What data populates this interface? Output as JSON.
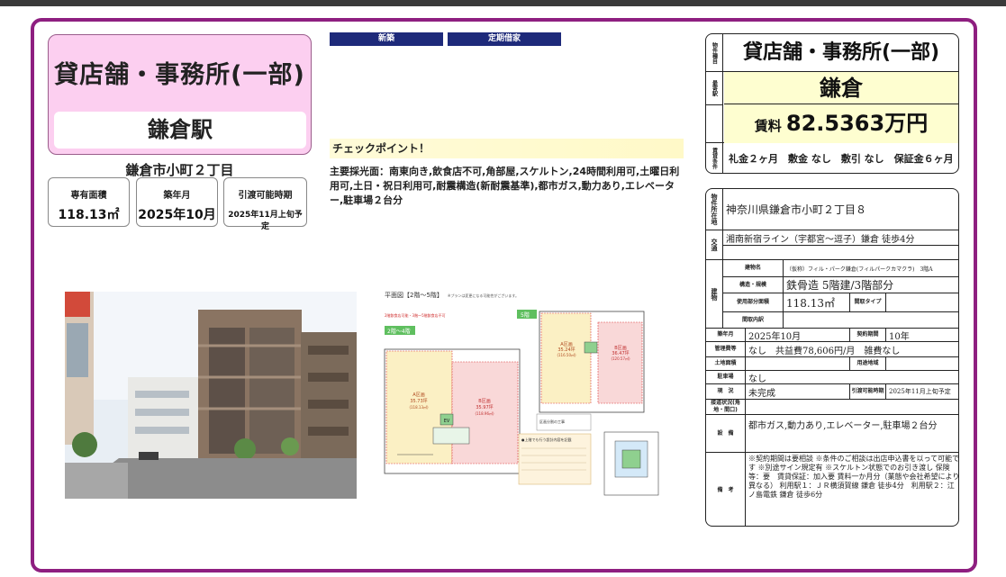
{
  "listing": {
    "type": "貸店舗・事務所(一部)",
    "station": "鎌倉駅",
    "address_short": "鎌倉市小町２丁目",
    "specs": [
      {
        "label": "専有面積",
        "value": "118.13㎡"
      },
      {
        "label": "築年月",
        "value": "2025年10月"
      },
      {
        "label": "引渡可能時期",
        "value": "2025年11月上旬予定"
      }
    ],
    "tags": [
      "新築",
      "定期借家"
    ],
    "check_title": "チェックポイント！",
    "check_body": "主要採光面：南東向き,飲食店不可,角部屋,スケルトン,24時間利用可,土曜日利用可,土日・祝日利用可,耐震構造(新耐震基準),都市ガス,動力あり,エレベーター,駐車場２台分"
  },
  "floorplan": {
    "title": "平面図【2階～5階】",
    "note": "※プランは変更になる可能性がございます。",
    "label_24": "2階～4階",
    "label_5": "5階",
    "area_a": "A区画",
    "area_a_val": "35.73坪",
    "area_a_sub": "(118.13㎡)",
    "area_b": "B区画",
    "area_b_val": "35.97坪",
    "area_b_sub": "(118.96㎡)",
    "area_a5": "A区画",
    "area_a5_val": "35.24坪",
    "area_a5_sub": "(116.50㎡)",
    "area_b5": "B区画",
    "area_b5_val": "36.47坪",
    "area_b5_sub": "(120.57㎡)",
    "ev": "EV",
    "red_note": "2階飲食店可能・3階～5階飲食店不可",
    "note_box": "●上階でも行う設計内容を記載",
    "divide_note": "区画分割の工事"
  },
  "panel": {
    "label_type": "物件種目",
    "type": "貸店舗・事務所(一部)",
    "label_station": "最寄駅",
    "station": "鎌倉",
    "label_terms": "賃貸条件",
    "rent_label": "賃料",
    "rent_value": "82.5363万円",
    "terms": "礼金２ヶ月　敷金 なし　敷引 なし　保証金６ヶ月",
    "label_address": "物件所在地",
    "address": "神奈川県鎌倉市小町２丁目８",
    "label_transport": "交通",
    "transport": "湘南新宿ライン（宇都宮～逗子）鎌倉 徒歩4分",
    "label_building": "建物",
    "label_bname": "建物名",
    "bname": "（仮称）フィル・パーク鎌倉(フィルパークカマクラ)　3階A",
    "label_structure": "構造・規模",
    "structure": "鉄骨造 5階建/3階部分",
    "label_area": "使用部分面積",
    "area": "118.13㎡",
    "label_layout": "間取タイプ",
    "label_rooms": "間取内訳",
    "label_built": "築年月",
    "built": "2025年10月",
    "label_contract": "契約期間",
    "contract": "10年",
    "label_mgmt": "管理費等",
    "mgmt": "なし　共益費78,606円/月　雑費なし",
    "label_land": "土地面積",
    "label_use": "用途地域",
    "label_parking": "駐車場",
    "parking": "なし",
    "label_status": "現　況",
    "status": "未完成",
    "label_delivery": "引渡可能時期",
    "delivery": "2025年11月上旬予定",
    "label_road": "接道状況(角地・間口)",
    "label_equip": "設　備",
    "equip": "都市ガス,動力あり,エレベーター,駐車場２台分",
    "label_remarks": "備　考",
    "remarks": "※契約期間は要相談 ※条件のご相談は出店申込書を以って可能です ※別途サイン規定有 ※スケルトン状態でのお引き渡し 保険等：要　賃貸保証：加入要 賃料一か月分（業態や会社希望により異なる） 利用駅１：ＪＲ横須賀線 鎌倉 徒歩4分　利用駅２：江ノ島電鉄 鎌倉 徒歩6分"
  }
}
